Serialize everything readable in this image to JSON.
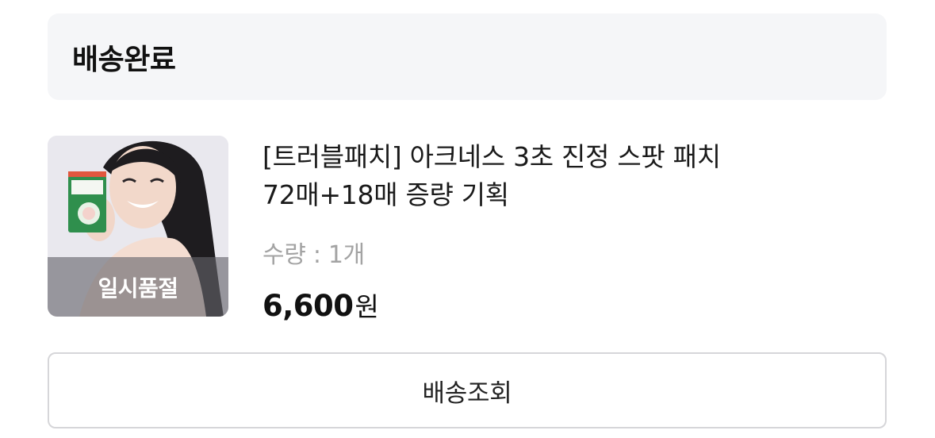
{
  "order": {
    "status_title": "배송완료"
  },
  "product": {
    "image_icon": "product-photo-icon",
    "soldout_badge": "일시품절",
    "name_line1": "[트러블패치] 아크네스 3초 진정 스팟 패치",
    "name_line2": "72매+18매 증량 기획",
    "quantity": "수량 : 1개",
    "price": "6,600",
    "price_unit": "원"
  },
  "actions": {
    "tracking_label": "배송조회"
  },
  "colors": {
    "header_bg": "#f5f6f8",
    "border": "#d6d6d9",
    "muted_text": "#a3a3a3"
  }
}
